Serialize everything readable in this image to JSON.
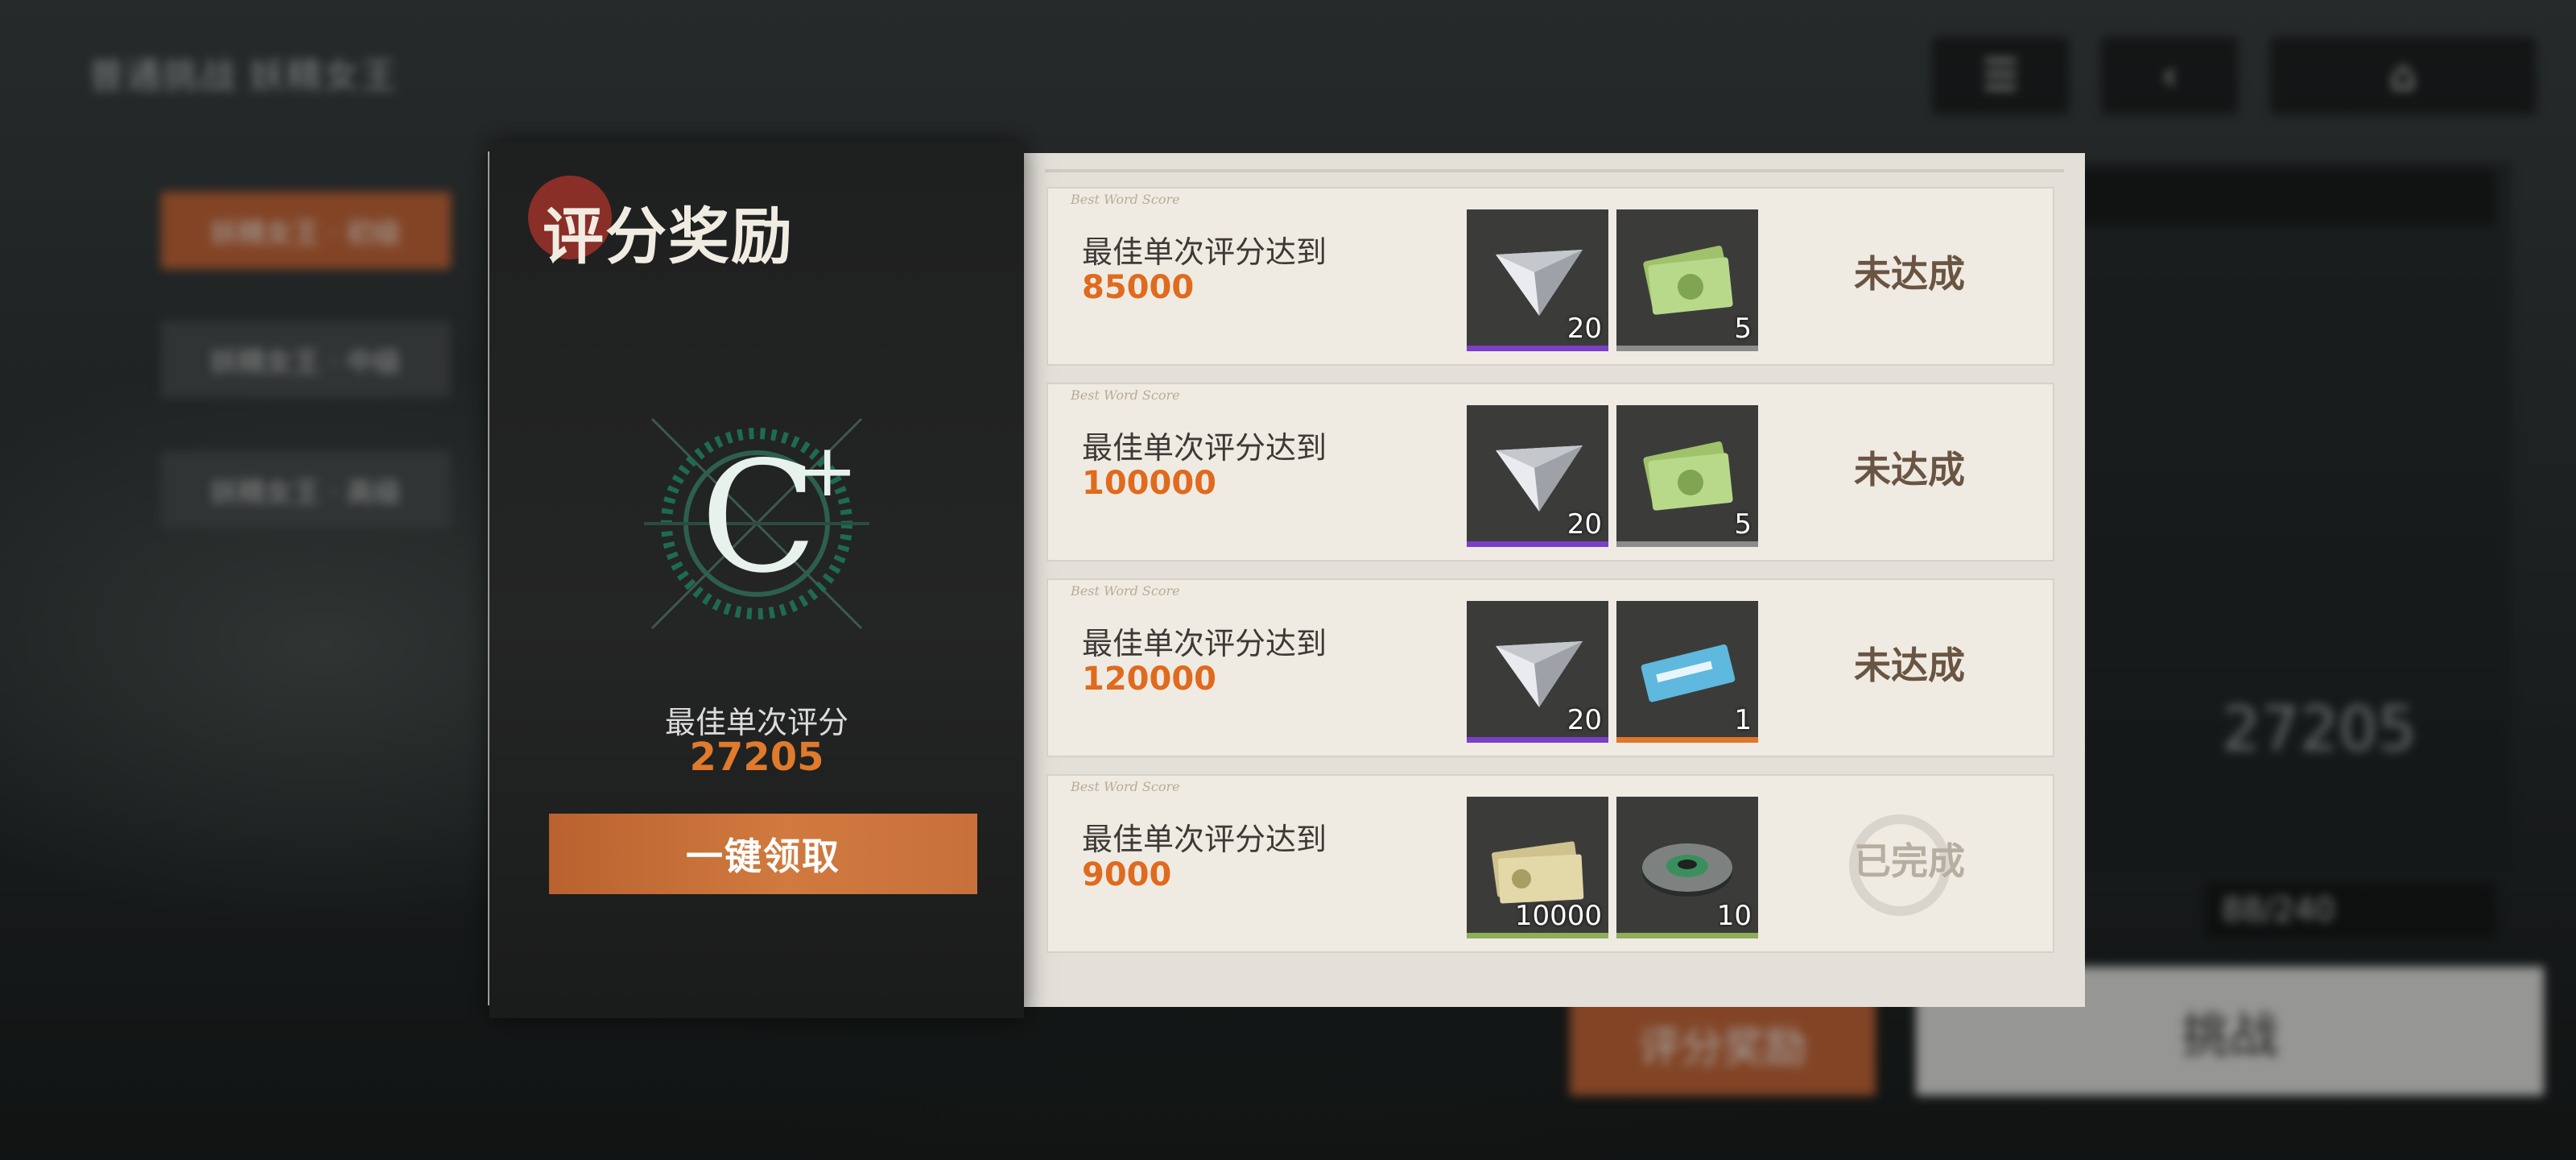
{
  "background": {
    "title": "普通挑战 妖精女王",
    "tabs": [
      "妖精女王 · 初级",
      "妖精女王 · 中级",
      "妖精女王 · 高级"
    ],
    "score_button": "评分奖励",
    "challenge_button": "挑战",
    "best_score": "27205",
    "stamina": "88/240"
  },
  "dialog": {
    "title": "评分奖励",
    "rank": {
      "letter": "C",
      "modifier": "+"
    },
    "best_label": "最佳单次评分",
    "best_value": "27205",
    "claim_all": "一键领取"
  },
  "rewards": [
    {
      "condition": "最佳单次评分达到",
      "target": "85000",
      "items": [
        {
          "icon": "paper-plane-ticket-icon",
          "qty": "20",
          "rarity_color": "#7b3fc8"
        },
        {
          "icon": "cash-bundle-icon",
          "qty": "5",
          "rarity_color": "#8c8c8c"
        }
      ],
      "status": "未达成"
    },
    {
      "condition": "最佳单次评分达到",
      "target": "100000",
      "items": [
        {
          "icon": "paper-plane-ticket-icon",
          "qty": "20",
          "rarity_color": "#7b3fc8"
        },
        {
          "icon": "cash-bundle-icon",
          "qty": "5",
          "rarity_color": "#8c8c8c"
        }
      ],
      "status": "未达成"
    },
    {
      "condition": "最佳单次评分达到",
      "target": "120000",
      "items": [
        {
          "icon": "paper-plane-ticket-icon",
          "qty": "20",
          "rarity_color": "#7b3fc8"
        },
        {
          "icon": "blue-voucher-icon",
          "qty": "1",
          "rarity_color": "#e0762c"
        }
      ],
      "status": "未达成"
    },
    {
      "condition": "最佳单次评分达到",
      "target": "9000",
      "items": [
        {
          "icon": "credit-notes-icon",
          "qty": "10000",
          "rarity_color": "#8fae5a"
        },
        {
          "icon": "gear-disc-icon",
          "qty": "10",
          "rarity_color": "#8fae5a"
        }
      ],
      "status": "已完成"
    }
  ]
}
